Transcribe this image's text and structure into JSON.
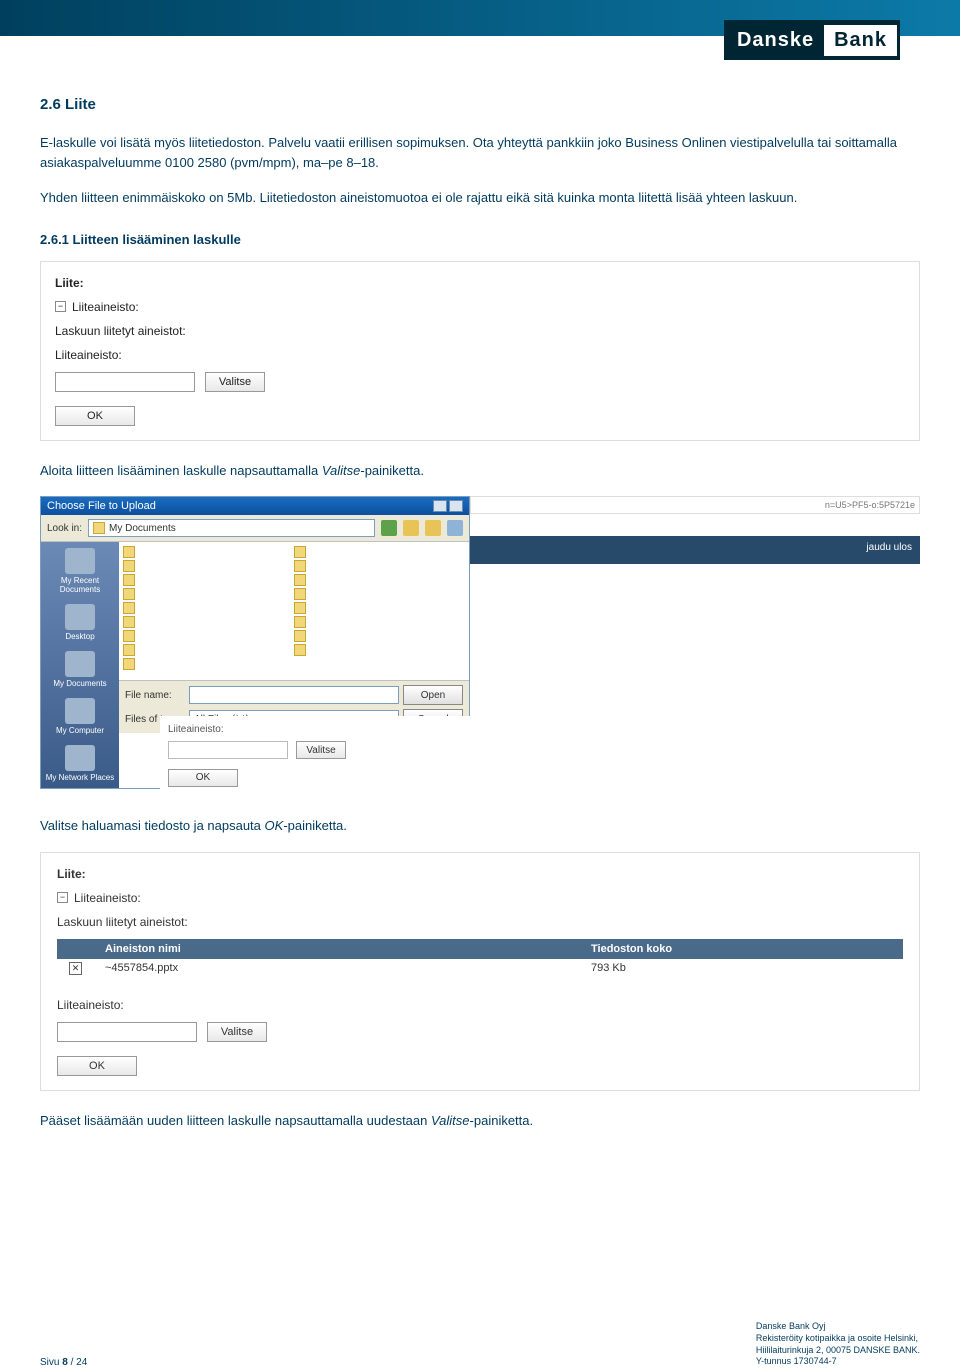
{
  "header": {
    "logo_left": "Danske",
    "logo_right": "Bank"
  },
  "section": {
    "title": "2.6 Liite",
    "para1": "E-laskulle voi lisätä myös liitetiedoston. Palvelu vaatii erillisen sopimuksen. Ota yhteyttä pankkiin joko Business Onlinen viestipalvelulla tai soittamalla asiakaspalveluumme 0100 2580 (pvm/mpm), ma–pe 8–18.",
    "para2": "Yhden liitteen enimmäiskoko on 5Mb. Liitetiedoston aineistomuotoa ei ole rajattu eikä sitä kuinka monta liitettä lisää yhteen laskuun.",
    "subsection_title": "2.6.1 Liitteen lisääminen laskulle"
  },
  "panel1": {
    "heading": "Liite:",
    "collapse_label": "Liiteaineisto:",
    "text1": "Laskuun liitetyt aineistot:",
    "text2": "Liiteaineisto:",
    "btn_valitse": "Valitse",
    "btn_ok": "OK"
  },
  "narrative1_a": "Aloita liitteen lisääminen laskulle napsauttamalla ",
  "narrative1_b": "Valitse",
  "narrative1_c": "-painiketta.",
  "file_dialog": {
    "title": "Choose File to Upload",
    "lookin_lbl": "Look in:",
    "lookin_val": "My Documents",
    "side": [
      "My Recent Documents",
      "Desktop",
      "My Documents",
      "My Computer",
      "My Network Places"
    ],
    "filename_lbl": "File name:",
    "filetype_lbl": "Files of type:",
    "filetype_val": "All Files (*.*)",
    "btn_open": "Open",
    "btn_cancel": "Cancel",
    "bg_url": "n=U5>PF5-o:5P5721e",
    "bg_logout": "jaudu ulos",
    "bg_label": "Liiteaineisto:",
    "bg_btn_valitse": "Valitse",
    "bg_btn_ok": "OK"
  },
  "narrative2_a": "Valitse haluamasi tiedosto ja napsauta ",
  "narrative2_b": "OK",
  "narrative2_c": "-painiketta.",
  "panel2": {
    "heading": "Liite:",
    "collapse_label": "Liiteaineisto:",
    "text1": "Laskuun liitetyt aineistot:",
    "col_name": "Aineiston nimi",
    "col_size": "Tiedoston koko",
    "row_name": "~4557854.pptx",
    "row_size": "793 Kb",
    "text2": "Liiteaineisto:",
    "btn_valitse": "Valitse",
    "btn_ok": "OK"
  },
  "narrative3_a": "Pääset lisäämään uuden liitteen laskulle napsauttamalla uudestaan ",
  "narrative3_b": "Valitse",
  "narrative3_c": "-painiketta.",
  "footer": {
    "page_a": "Sivu ",
    "page_b": "8",
    "page_c": " / 24",
    "line1": "Danske Bank Oyj",
    "line2": "Rekisteröity kotipaikka ja osoite Helsinki,",
    "line3": "Hiililaiturinkuja 2, 00075 DANSKE BANK.",
    "line4": "Y-tunnus 1730744-7"
  }
}
